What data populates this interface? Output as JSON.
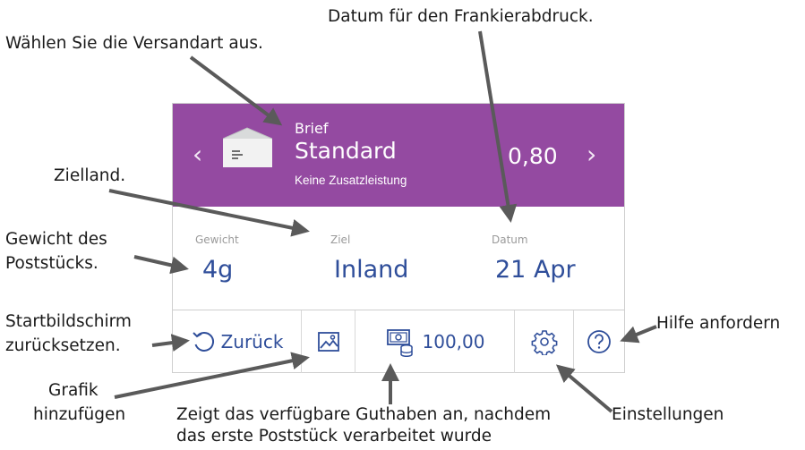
{
  "callouts": {
    "versandart": "Wählen Sie die Versandart aus.",
    "datum": "Datum für den Frankierabdruck.",
    "zielland": "Zielland.",
    "gewicht_1": "Gewicht des",
    "gewicht_2": "Poststücks.",
    "start_1": "Startbildschirm",
    "start_2": "zurücksetzen.",
    "grafik_1": "Grafik",
    "grafik_2": "hinzufügen",
    "guthaben_1": "Zeigt das verfügbare Guthaben an, nachdem",
    "guthaben_2": "das erste Poststück verarbeitet wurde",
    "einstellungen": "Einstellungen",
    "hilfe": "Hilfe anfordern"
  },
  "header": {
    "mail_type": "Brief",
    "product": "Standard",
    "services": "Keine Zusatzleistung",
    "price": "0,80",
    "prev_glyph": "‹",
    "next_glyph": "›",
    "background_color": "#944aa1"
  },
  "fields": {
    "weight_label": "Gewicht",
    "weight_value": "4g",
    "destination_label": "Ziel",
    "destination_value": "Inland",
    "date_label": "Datum",
    "date_value": "21 Apr"
  },
  "toolbar": {
    "back_label": "Zurück",
    "balance": "100,00"
  },
  "colors": {
    "accent_blue": "#2f4e9a",
    "purple": "#944aa1"
  },
  "icons": [
    "envelope-icon",
    "undo-icon",
    "image-icon",
    "money-icon",
    "gear-icon",
    "help-icon"
  ]
}
